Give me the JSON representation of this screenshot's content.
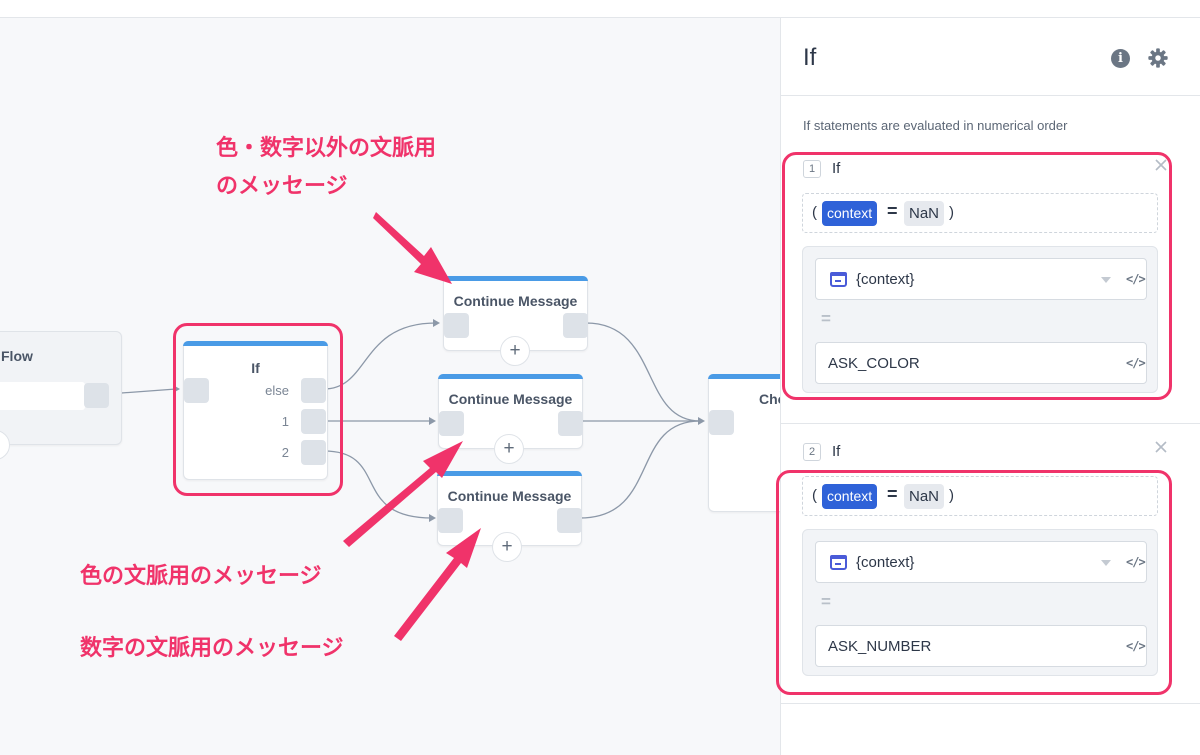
{
  "canvas": {
    "flow_node": {
      "title_partial": "Flow"
    },
    "if_node": {
      "title": "If",
      "ports": [
        "else",
        "1",
        "2"
      ]
    },
    "message_nodes": [
      {
        "title": "Continue Message",
        "add_label": "+"
      },
      {
        "title": "Continue Message",
        "add_label": "+"
      },
      {
        "title": "Continue Message",
        "add_label": "+"
      }
    ],
    "choice_node": {
      "title_partial": "Cho"
    }
  },
  "annotations": {
    "top_line1": "色・数字以外の文脈用",
    "top_line2": "のメッセージ",
    "middle": "色の文脈用のメッセージ",
    "bottom": "数字の文脈用のメッセージ"
  },
  "panel": {
    "title": "If",
    "info_label": "i",
    "description": "If statements are evaluated in numerical order",
    "statements": [
      {
        "number": "1",
        "title": "If",
        "open_paren": "(",
        "variable": "context",
        "operator": "=",
        "value": "NaN",
        "close_paren": ")",
        "left_field": "{context}",
        "equals": "=",
        "right_field": "ASK_COLOR",
        "code_label": "</>"
      },
      {
        "number": "2",
        "title": "If",
        "open_paren": "(",
        "variable": "context",
        "operator": "=",
        "value": "NaN",
        "close_paren": ")",
        "left_field": "{context}",
        "equals": "=",
        "right_field": "ASK_NUMBER",
        "code_label": "</>"
      }
    ]
  },
  "colors": {
    "highlight": "#f0336a",
    "node_accent": "#4a9be6",
    "chip": "#2f62d8"
  }
}
